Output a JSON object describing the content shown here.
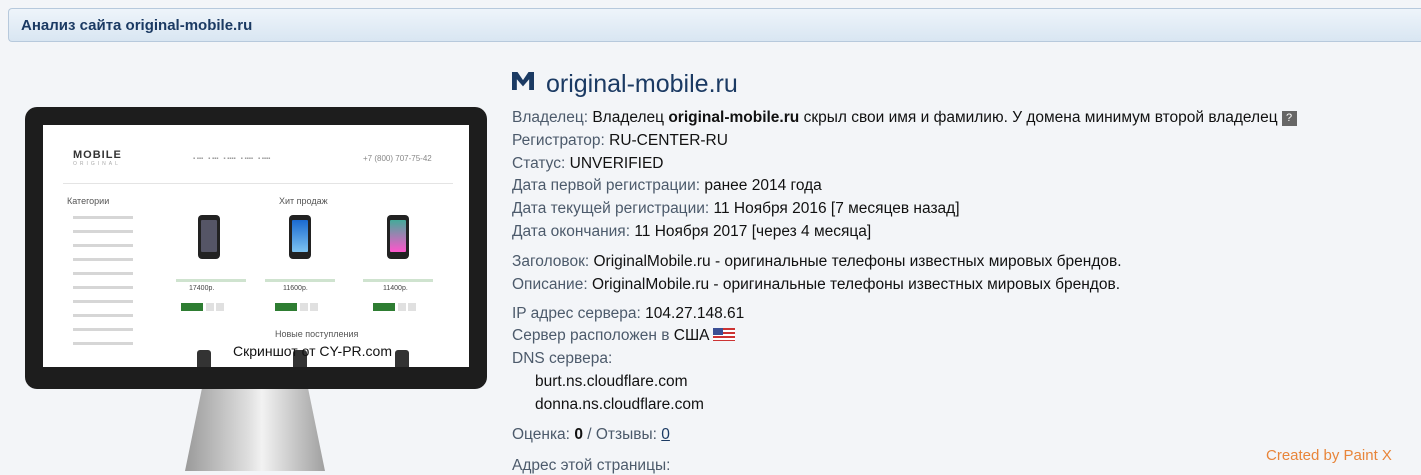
{
  "header": {
    "title": "Анализ сайта original-mobile.ru"
  },
  "screenshot": {
    "logo": "MOBILE",
    "logo_sub": "ORIGINAL",
    "phone": "+7 (800) 707-75-42",
    "categories_label": "Категории",
    "hits_label": "Хит продаж",
    "prices": [
      "17400р.",
      "11600р.",
      "11400р."
    ],
    "new_label": "Новые поступления",
    "watermark": "Скриншот от CY-PR.com"
  },
  "site": {
    "domain": "original-mobile.ru"
  },
  "owner": {
    "label": "Владелец:",
    "pre": "Владелец",
    "domain": "original-mobile.ru",
    "post": "скрыл свои имя и фамилию. У домена минимум второй владелец",
    "help": "?"
  },
  "registrar": {
    "label": "Регистратор:",
    "value": "RU-CENTER-RU"
  },
  "status": {
    "label": "Статус:",
    "value": "UNVERIFIED"
  },
  "first_reg": {
    "label": "Дата первой регистрации:",
    "value": "ранее 2014 года"
  },
  "current_reg": {
    "label": "Дата текущей регистрации:",
    "value": "11 Ноября 2016 [7 месяцев назад]"
  },
  "expiry": {
    "label": "Дата окончания:",
    "value": "11 Ноября 2017 [через 4 месяца]"
  },
  "title_meta": {
    "label": "Заголовок:",
    "value": "OriginalMobile.ru - оригинальные телефоны известных мировых брендов."
  },
  "description": {
    "label": "Описание:",
    "value": "OriginalMobile.ru - оригинальные телефоны известных мировых брендов."
  },
  "ip": {
    "label": "IP адрес сервера:",
    "value": "104.27.148.61"
  },
  "location": {
    "label": "Сервер расположен в",
    "value": "США"
  },
  "dns": {
    "label": "DNS сервера:",
    "servers": [
      "burt.ns.cloudflare.com",
      "donna.ns.cloudflare.com"
    ]
  },
  "rating": {
    "label": "Оценка:",
    "value": "0",
    "sep": "/",
    "reviews_label": "Отзывы:",
    "reviews": "0"
  },
  "page_address": {
    "label": "Адрес этой страницы:"
  },
  "credit": "Created by Paint X"
}
